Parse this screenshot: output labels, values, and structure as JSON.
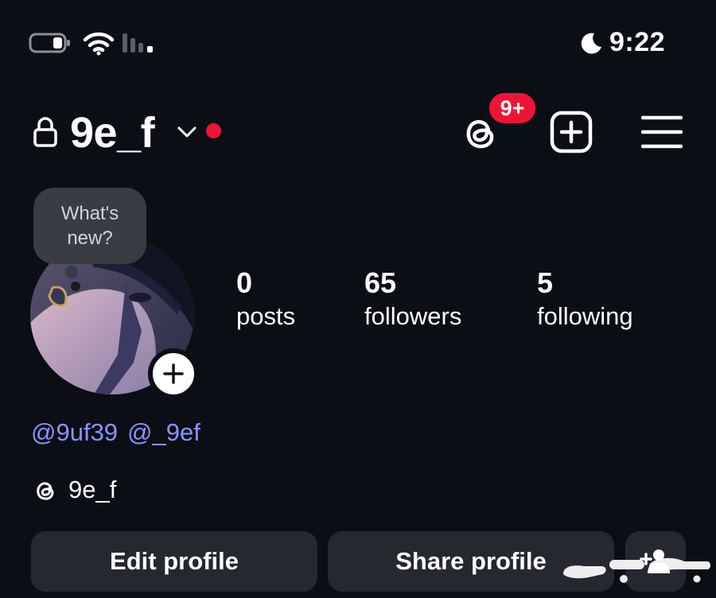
{
  "status_bar": {
    "time": "9:22",
    "icons": [
      "battery-icon",
      "wifi-icon",
      "cellular-signal-icon",
      "do-not-disturb-moon-icon"
    ]
  },
  "header": {
    "username": "9e_f",
    "icons": [
      "lock-icon",
      "chevron-down-icon",
      "threads-icon",
      "plus-square-icon",
      "menu-icon"
    ],
    "threads_badge": "9+",
    "accent_color": "#ee1438"
  },
  "profile": {
    "note_bubble": {
      "line1": "What's",
      "line2": "new?"
    },
    "stats": [
      {
        "count": "0",
        "label": "posts"
      },
      {
        "count": "65",
        "label": "followers"
      },
      {
        "count": "5",
        "label": "following"
      }
    ],
    "mentions": [
      "@9uf39",
      "@_9ef"
    ],
    "mention_color": "#8a92ff",
    "threads_handle": "9e_f"
  },
  "actions": {
    "edit_profile": "Edit profile",
    "share_profile": "Share profile",
    "discover_people_icon": "add-person-icon"
  },
  "watermark": {
    "text": "حراج"
  }
}
